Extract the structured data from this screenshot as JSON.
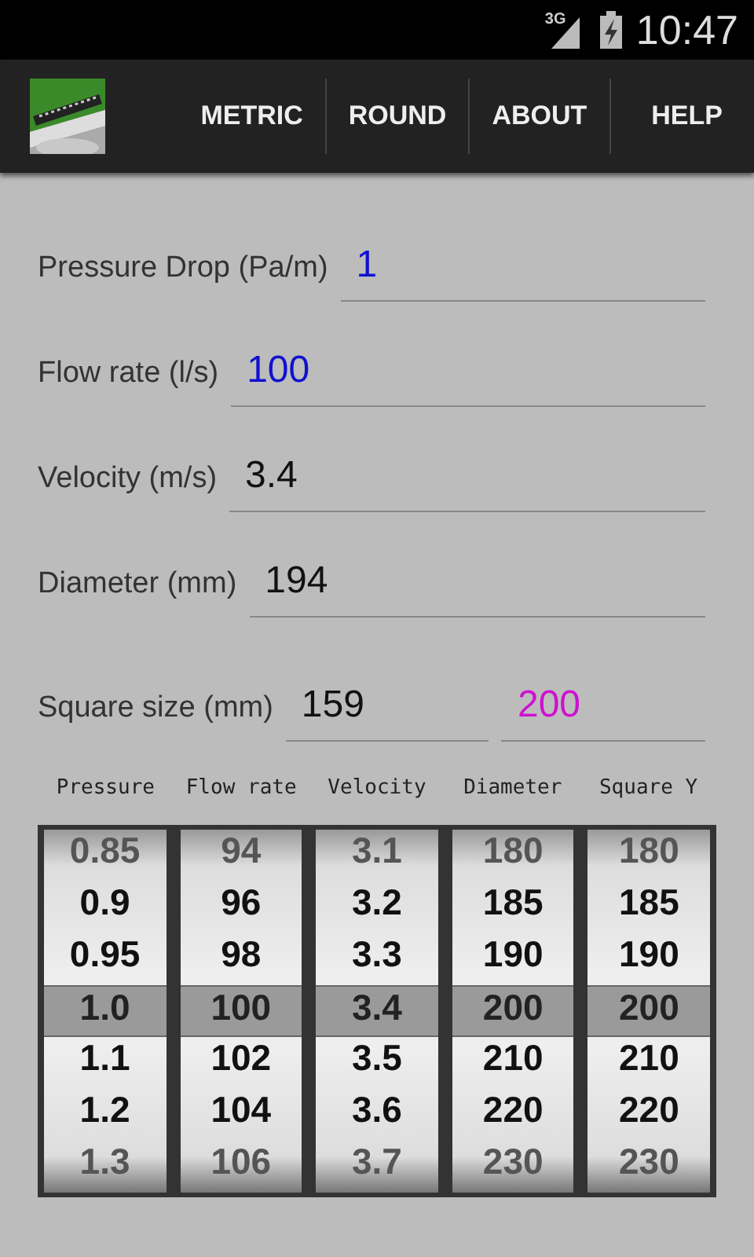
{
  "status_bar": {
    "network": "3G",
    "time": "10:47"
  },
  "action_bar": {
    "actions": [
      {
        "label": "METRIC"
      },
      {
        "label": "ROUND"
      },
      {
        "label": "ABOUT"
      },
      {
        "label": "HELP"
      }
    ]
  },
  "fields": [
    {
      "label": "Pressure Drop (Pa/m)",
      "values": [
        {
          "text": "1",
          "color": "#1010d0"
        }
      ]
    },
    {
      "label": "Flow rate (l/s)",
      "values": [
        {
          "text": "100",
          "color": "#1010d0"
        }
      ]
    },
    {
      "label": "Velocity (m/s)",
      "values": [
        {
          "text": "3.4",
          "color": "#111111"
        }
      ]
    },
    {
      "label": "Diameter (mm)",
      "values": [
        {
          "text": "194",
          "color": "#111111"
        }
      ]
    },
    {
      "label": "Square size (mm)",
      "values": [
        {
          "text": "159",
          "color": "#111111"
        },
        {
          "text": "200",
          "color": "#d010d0"
        }
      ]
    }
  ],
  "wheels": [
    {
      "header": "Pressure",
      "items": [
        {
          "text": "0.85",
          "selected": false
        },
        {
          "text": "0.9",
          "selected": false
        },
        {
          "text": "0.95",
          "selected": false
        },
        {
          "text": "1.0",
          "selected": true
        },
        {
          "text": "1.1",
          "selected": false
        },
        {
          "text": "1.2",
          "selected": false
        },
        {
          "text": "1.3",
          "selected": false
        }
      ]
    },
    {
      "header": "Flow rate",
      "items": [
        {
          "text": "94",
          "selected": false
        },
        {
          "text": "96",
          "selected": false
        },
        {
          "text": "98",
          "selected": false
        },
        {
          "text": "100",
          "selected": true
        },
        {
          "text": "102",
          "selected": false
        },
        {
          "text": "104",
          "selected": false
        },
        {
          "text": "106",
          "selected": false
        }
      ]
    },
    {
      "header": "Velocity",
      "items": [
        {
          "text": "3.1",
          "selected": false
        },
        {
          "text": "3.2",
          "selected": false
        },
        {
          "text": "3.3",
          "selected": false
        },
        {
          "text": "3.4",
          "selected": true
        },
        {
          "text": "3.5",
          "selected": false
        },
        {
          "text": "3.6",
          "selected": false
        },
        {
          "text": "3.7",
          "selected": false
        }
      ]
    },
    {
      "header": "Diameter",
      "items": [
        {
          "text": "180",
          "selected": false
        },
        {
          "text": "185",
          "selected": false
        },
        {
          "text": "190",
          "selected": false
        },
        {
          "text": "200",
          "selected": true
        },
        {
          "text": "210",
          "selected": false
        },
        {
          "text": "220",
          "selected": false
        },
        {
          "text": "230",
          "selected": false
        }
      ]
    },
    {
      "header": "Square Y",
      "items": [
        {
          "text": "180",
          "selected": false
        },
        {
          "text": "185",
          "selected": false
        },
        {
          "text": "190",
          "selected": false
        },
        {
          "text": "200",
          "selected": true
        },
        {
          "text": "210",
          "selected": false
        },
        {
          "text": "220",
          "selected": false
        },
        {
          "text": "230",
          "selected": false
        }
      ]
    }
  ]
}
